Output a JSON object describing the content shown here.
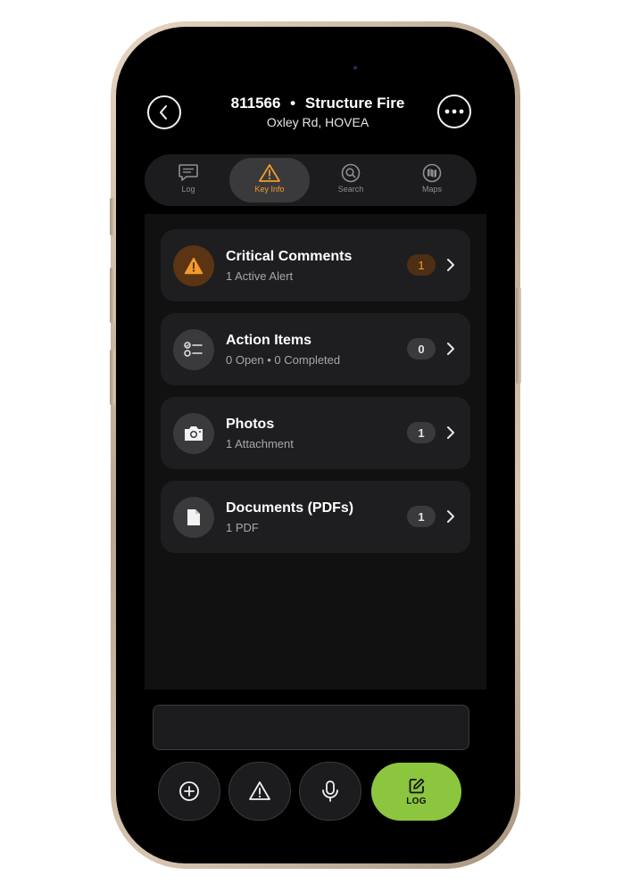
{
  "header": {
    "incident_number": "811566",
    "separator": "•",
    "incident_type": "Structure Fire",
    "location": "Oxley Rd, HOVEA"
  },
  "tabs": [
    {
      "label": "Log",
      "icon": "chat-icon",
      "active": false
    },
    {
      "label": "Key Info",
      "icon": "warning-icon",
      "active": true
    },
    {
      "label": "Search",
      "icon": "search-icon",
      "active": false
    },
    {
      "label": "Maps",
      "icon": "map-icon",
      "active": false
    }
  ],
  "cards": [
    {
      "title": "Critical Comments",
      "subtitle": "1 Active Alert",
      "count": "1",
      "icon": "warning-icon"
    },
    {
      "title": "Action Items",
      "subtitle": "0 Open • 0 Completed",
      "count": "0",
      "icon": "checklist-icon"
    },
    {
      "title": "Photos",
      "subtitle": "1 Attachment",
      "count": "1",
      "icon": "camera-icon"
    },
    {
      "title": "Documents (PDFs)",
      "subtitle": "1 PDF",
      "count": "1",
      "icon": "document-icon"
    }
  ],
  "actions": {
    "log_label": "LOG"
  },
  "colors": {
    "accent_orange": "#f39a2d",
    "log_green": "#8cc63f",
    "card_bg": "#1e1e20"
  }
}
